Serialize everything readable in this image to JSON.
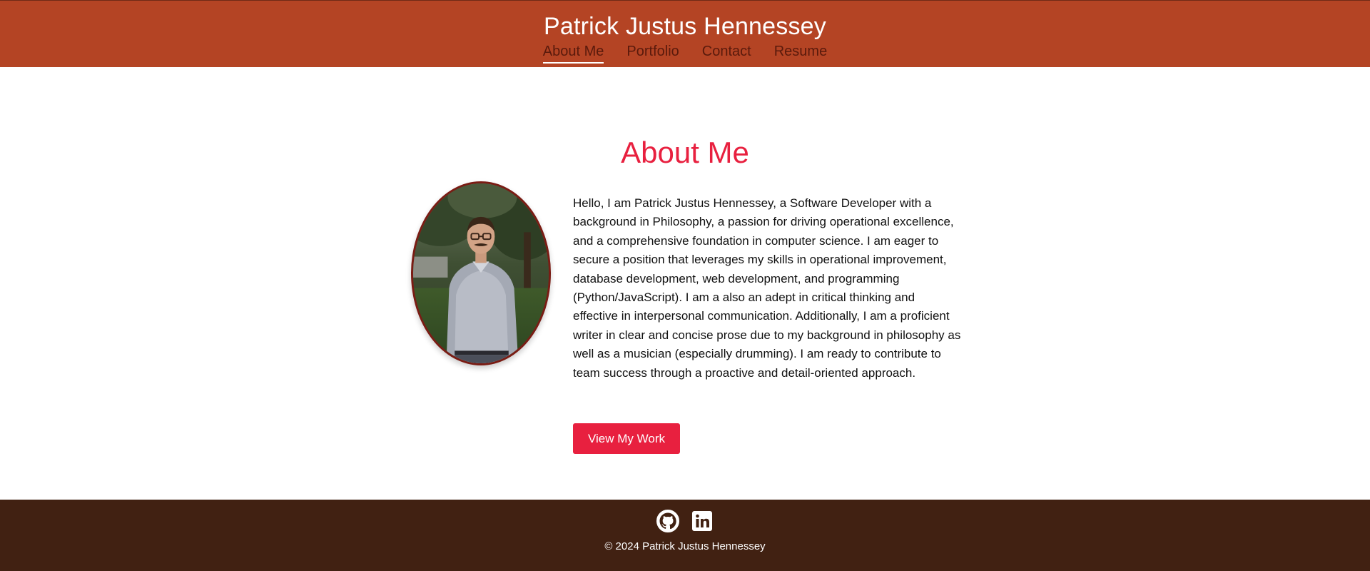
{
  "header": {
    "title": "Patrick Justus Hennessey",
    "nav": [
      {
        "label": "About Me",
        "active": true
      },
      {
        "label": "Portfolio",
        "active": false
      },
      {
        "label": "Contact",
        "active": false
      },
      {
        "label": "Resume",
        "active": false
      }
    ]
  },
  "main": {
    "heading": "About Me",
    "bio": "Hello, I am Patrick Justus Hennessey, a Software Developer with a background in Philosophy, a passion for driving operational excellence, and a comprehensive foundation in computer science. I am eager to secure a position that leverages my skills in operational improvement, database development, web development, and programming (Python/JavaScript). I am a also an adept in critical thinking and effective in interpersonal communication. Additionally, I am a proficient writer in clear and concise prose due to my background in philosophy as well as a musician (especially drumming). I am ready to contribute to team success through a proactive and detail-oriented approach.",
    "button_label": "View My Work",
    "photo_icon": "profile-photo"
  },
  "footer": {
    "social": [
      {
        "icon": "github-icon"
      },
      {
        "icon": "linkedin-icon"
      }
    ],
    "copyright": "© 2024 Patrick Justus Hennessey"
  },
  "colors": {
    "header_bg": "#b44424",
    "accent": "#e8203f",
    "footer_bg": "#412112"
  }
}
